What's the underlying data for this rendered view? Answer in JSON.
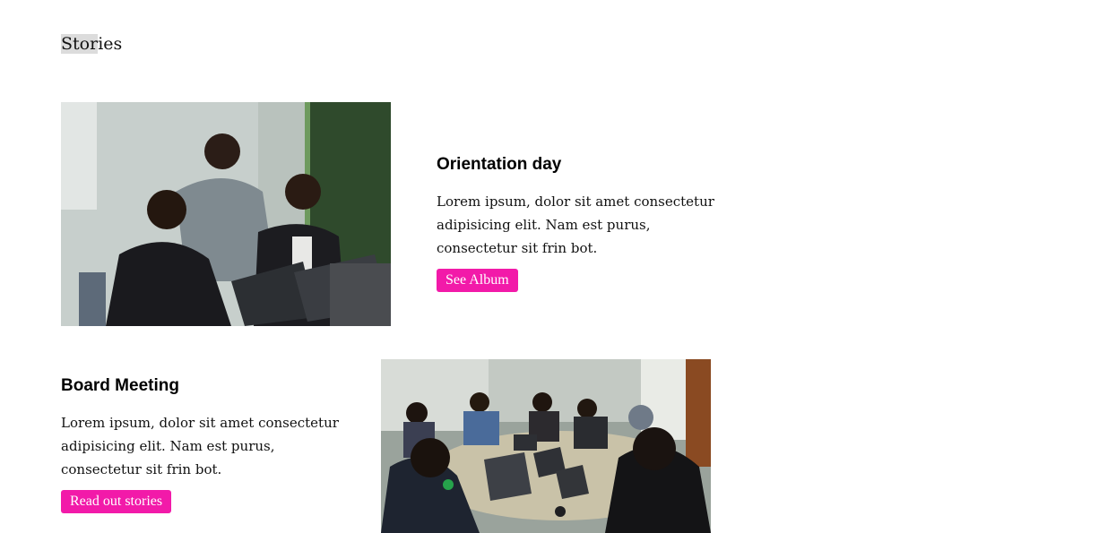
{
  "page": {
    "title_highlighted": "Stor",
    "title_rest": "ies"
  },
  "stories": [
    {
      "heading": "Orientation day",
      "body": "Lorem ipsum, dolor sit amet consectetur adipisicing elit. Nam est purus, consectetur sit frin bot.",
      "button_label": "See Album",
      "photo_icon": "photo-icon"
    },
    {
      "heading": "Board Meeting",
      "body": "Lorem ipsum, dolor sit amet consectetur adipisicing elit. Nam est purus, consectetur sit frin bot.",
      "button_label": "Read out stories",
      "photo_icon": "photo-icon"
    }
  ],
  "colors": {
    "accent": "#f21aa9",
    "title_highlight": "#dcdcdc",
    "text": "#111111"
  }
}
